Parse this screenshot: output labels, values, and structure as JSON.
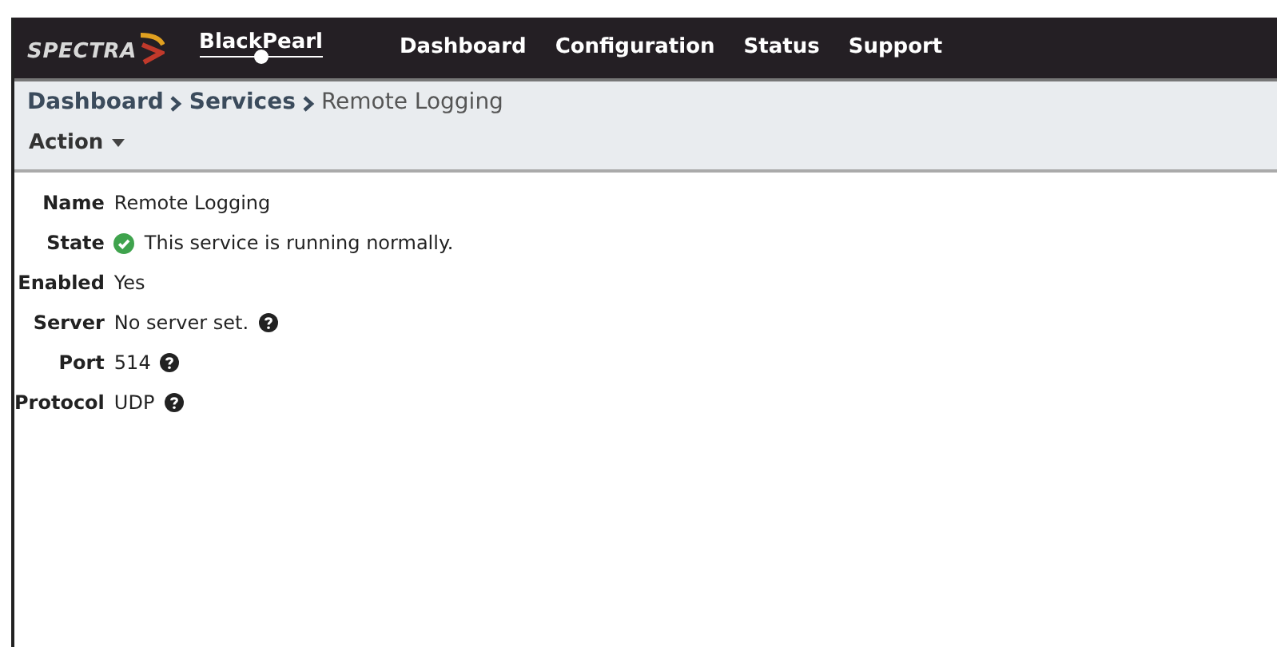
{
  "header": {
    "logo_text": "SPECTRA",
    "product": "BlackPearl",
    "nav": [
      "Dashboard",
      "Configuration",
      "Status",
      "Support"
    ]
  },
  "breadcrumb": {
    "links": [
      "Dashboard",
      "Services"
    ],
    "current": "Remote Logging"
  },
  "action_menu": {
    "label": "Action"
  },
  "fields": [
    {
      "label": "Name",
      "value": "Remote Logging",
      "kind": "plain"
    },
    {
      "label": "State",
      "value": "This service is running normally.",
      "kind": "status"
    },
    {
      "label": "Enabled",
      "value": "Yes",
      "kind": "plain"
    },
    {
      "label": "Server",
      "value": "No server set.",
      "kind": "help"
    },
    {
      "label": "Port",
      "value": "514",
      "kind": "help"
    },
    {
      "label": "Protocol",
      "value": "UDP",
      "kind": "help"
    }
  ]
}
